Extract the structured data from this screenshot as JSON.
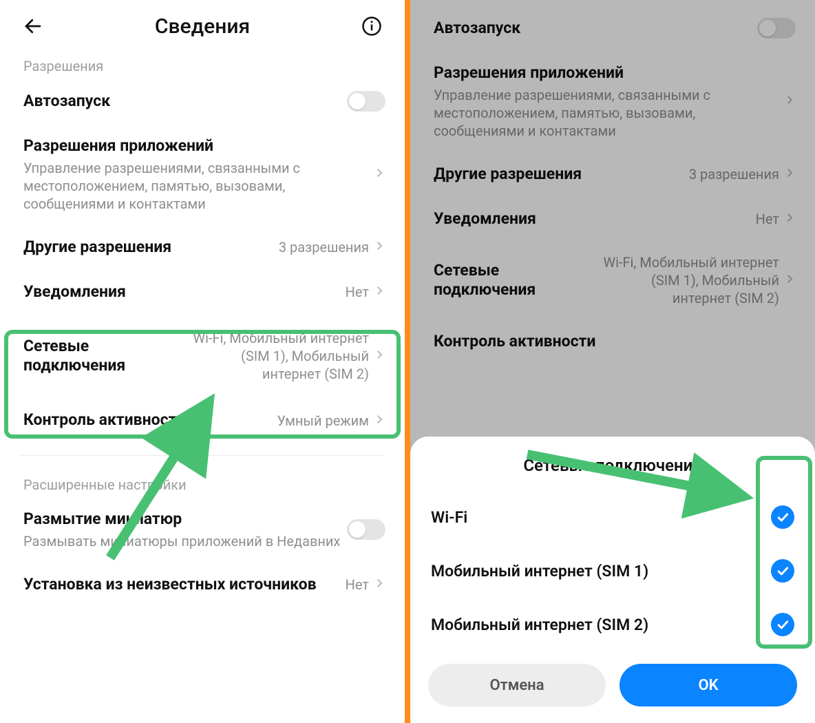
{
  "left": {
    "header_title": "Сведения",
    "section_permissions": "Разрешения",
    "autostart": "Автозапуск",
    "app_perms_title": "Разрешения приложений",
    "app_perms_sub": "Управление разрешениями, связанными с местоположением, памятью, вызовами, сообщениями и контактами",
    "other_perms_title": "Другие разрешения",
    "other_perms_value": "3 разрешения",
    "notifications_title": "Уведомления",
    "notifications_value": "Нет",
    "network_title": "Сетевые подключения",
    "network_value": "Wi-Fi, Мобильный интернет (SIM 1), Мобильный интернет (SIM 2)",
    "activity_title": "Контроль активности",
    "activity_value": "Умный режим",
    "section_advanced": "Расширенные настройки",
    "blur_title": "Размытие миниатюр",
    "blur_sub": "Размывать миниатюры приложений в Недавних",
    "unknown_title": "Установка из неизвестных источников",
    "unknown_value": "Нет"
  },
  "right": {
    "autostart": "Автозапуск",
    "app_perms_title": "Разрешения приложений",
    "app_perms_sub": "Управление разрешениями, связанными с местоположением, памятью, вызовами, сообщениями и контактами",
    "other_perms_title": "Другие разрешения",
    "other_perms_value": "3 разрешения",
    "notifications_title": "Уведомления",
    "notifications_value": "Нет",
    "network_title": "Сетевые подключения",
    "network_value": "Wi-Fi, Мобильный интернет (SIM 1), Мобильный интернет (SIM 2)",
    "activity_title": "Контроль активности"
  },
  "sheet": {
    "title": "Сетевые подключения",
    "options": [
      "Wi-Fi",
      "Мобильный интернет (SIM 1)",
      "Мобильный интернет (SIM 2)"
    ],
    "cancel": "Отмена",
    "ok": "OK"
  },
  "colors": {
    "highlight": "#48c072",
    "primary": "#0b84ff"
  }
}
